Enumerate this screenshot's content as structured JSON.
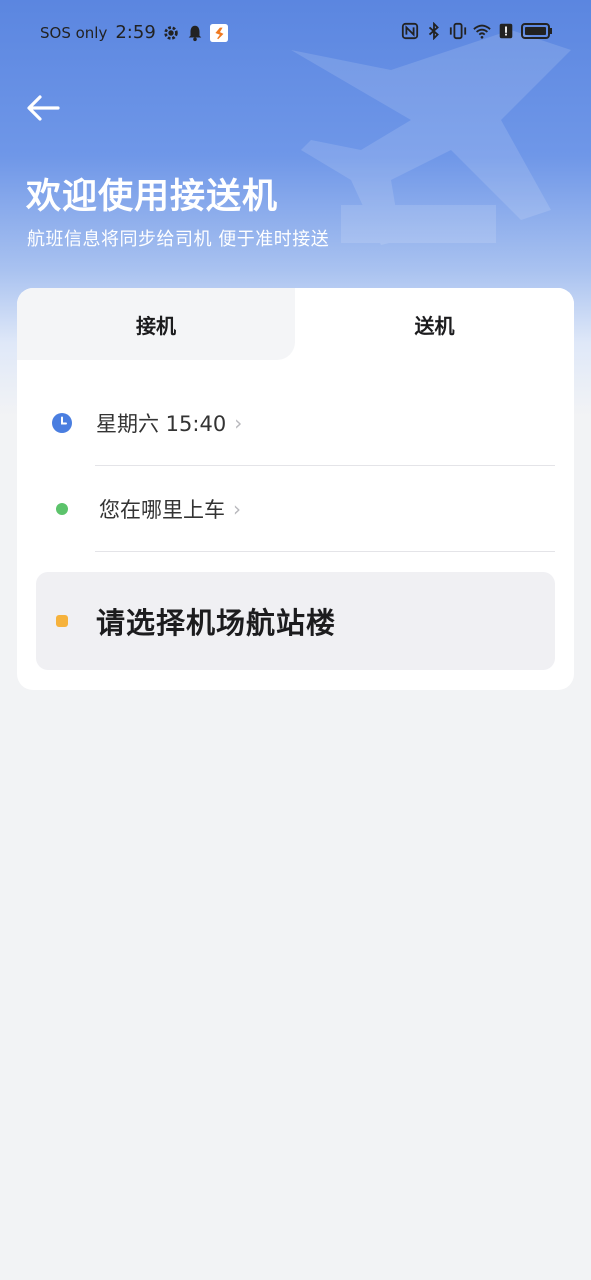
{
  "status_bar": {
    "carrier": "SOS only",
    "time": "2:59",
    "left_icons": [
      "gear-icon",
      "bell-icon",
      "runner-app-icon"
    ],
    "right_icons": [
      "nfc-icon",
      "bluetooth-icon",
      "vibrate-icon",
      "wifi-icon",
      "alert-icon",
      "battery-icon"
    ]
  },
  "header": {
    "title": "欢迎使用接送机",
    "subtitle": "航班信息将同步给司机 便于准时接送"
  },
  "tabs": [
    {
      "label": "接机",
      "selected": false
    },
    {
      "label": "送机",
      "selected": true
    }
  ],
  "form": {
    "time_label": "星期六 15:40",
    "pickup_label": "您在哪里上车",
    "terminal_label": "请选择机场航站楼"
  },
  "colors": {
    "accent_blue": "#4a7ee0",
    "green": "#5cc36b",
    "yellow": "#f6b23c"
  }
}
